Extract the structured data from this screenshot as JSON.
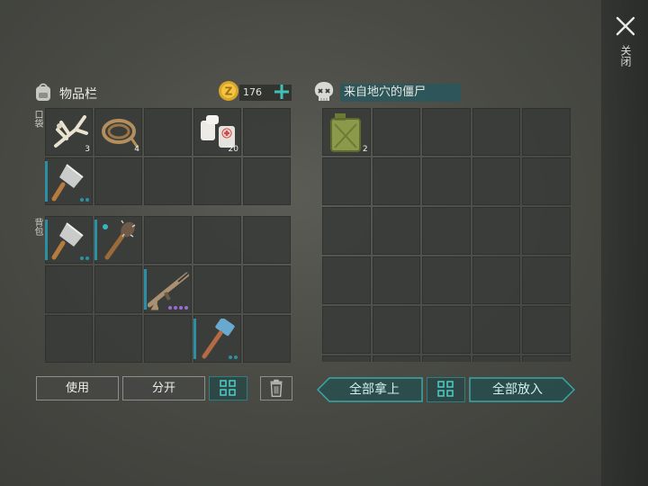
{
  "close": {
    "label": "关闭"
  },
  "inventory": {
    "title": "物品栏",
    "coins": "176",
    "pocket_label": "口袋",
    "backpack_label": "背包",
    "pocket": [
      {
        "item": "branches-icon",
        "count": "3"
      },
      {
        "item": "rope-icon",
        "count": "4"
      },
      {
        "item": "",
        "count": ""
      },
      {
        "item": "bandage-icon",
        "count": "20"
      },
      {
        "item": "",
        "count": ""
      },
      {
        "item": "cleaver-icon",
        "count": "",
        "bar": true,
        "dots": [
          "#2b8fa6",
          "#2b8fa6"
        ]
      },
      {
        "item": "",
        "count": ""
      },
      {
        "item": "",
        "count": ""
      },
      {
        "item": "",
        "count": ""
      },
      {
        "item": "",
        "count": ""
      }
    ],
    "backpack": [
      {
        "item": "cleaver-icon",
        "count": "",
        "bar": true,
        "dots": [
          "#2b8fa6",
          "#2b8fa6"
        ]
      },
      {
        "item": "spiked-club-icon",
        "count": "",
        "bar": true,
        "dots": []
      },
      {
        "item": "",
        "count": ""
      },
      {
        "item": "",
        "count": ""
      },
      {
        "item": "",
        "count": ""
      },
      {
        "item": "",
        "count": ""
      },
      {
        "item": "",
        "count": ""
      },
      {
        "item": "assault-rifle-icon",
        "count": "",
        "bar": true,
        "dots": [
          "#9a6bd6",
          "#9a6bd6",
          "#9a6bd6",
          "#9a6bd6"
        ]
      },
      {
        "item": "",
        "count": ""
      },
      {
        "item": "",
        "count": ""
      },
      {
        "item": "",
        "count": ""
      },
      {
        "item": "",
        "count": ""
      },
      {
        "item": "",
        "count": ""
      },
      {
        "item": "sledgehammer-icon",
        "count": "",
        "bar": true,
        "dots": [
          "#2b8fa6",
          "#2b8fa6"
        ]
      },
      {
        "item": "",
        "count": ""
      }
    ],
    "use_label": "使用",
    "split_label": "分开"
  },
  "loot": {
    "title": "来自地穴的僵尸",
    "items": [
      {
        "item": "jerrycan-icon",
        "count": "2"
      }
    ],
    "take_all_label": "全部拿上",
    "put_all_label": "全部放入"
  }
}
